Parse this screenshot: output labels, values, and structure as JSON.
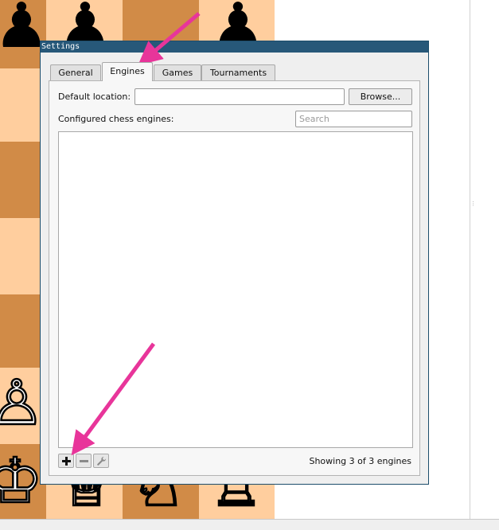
{
  "dialog": {
    "title": "Settings",
    "tabs": [
      {
        "label": "General"
      },
      {
        "label": "Engines"
      },
      {
        "label": "Games"
      },
      {
        "label": "Tournaments"
      }
    ],
    "active_tab": "Engines"
  },
  "engines_tab": {
    "default_location_label": "Default location:",
    "default_location_value": "",
    "browse_label": "Browse...",
    "configured_label": "Configured chess engines:",
    "search_placeholder": "Search",
    "engines": [],
    "status": "Showing 3 of 3 engines",
    "toolbar_icons": [
      "plus-icon",
      "minus-icon",
      "wrench-icon"
    ]
  },
  "board": {
    "colors": {
      "light": "#ffce9e",
      "dark": "#d18b47"
    },
    "visible_pieces": [
      "black-pawn",
      "black-pawn",
      "black-pawn",
      "white-pawn",
      "white-king",
      "white-queen",
      "white-knight",
      "white-rook"
    ]
  },
  "annotations": {
    "arrow_color": "#e8359a",
    "arrows": [
      "arrow-to-engines-tab",
      "arrow-to-add-engine-button"
    ]
  }
}
